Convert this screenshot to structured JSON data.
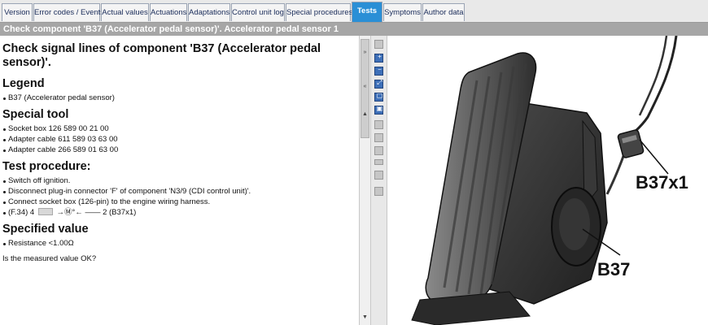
{
  "tabs": [
    {
      "label": "Version",
      "active": false
    },
    {
      "label": "Error codes / Events",
      "active": false
    },
    {
      "label": "Actual values",
      "active": false
    },
    {
      "label": "Actuations",
      "active": false
    },
    {
      "label": "Adaptations",
      "active": false
    },
    {
      "label": "Control unit log",
      "active": false
    },
    {
      "label": "Special procedures",
      "active": false
    },
    {
      "label": "Tests",
      "active": true
    },
    {
      "label": "Symptoms",
      "active": false
    },
    {
      "label": "Author data",
      "active": false
    }
  ],
  "title_bar": "Check component 'B37 (Accelerator pedal sensor)'. Accelerator pedal sensor 1",
  "content": {
    "heading": "Check signal lines of component 'B37 (Accelerator pedal sensor)'.",
    "legend_heading": "Legend",
    "legend_items": [
      "B37 (Accelerator pedal sensor)"
    ],
    "special_tool_heading": "Special tool",
    "special_tool_items": [
      "Socket box 126 589 00 21 00",
      "Adapter cable 611 589 03 63 00",
      "Adapter cable 266 589 01 63 00"
    ],
    "procedure_heading": "Test procedure:",
    "procedure_items": [
      "Switch off ignition.",
      "Disconnect plug-in connector 'F' of component 'N3/9 (CDI control unit)'.",
      "Connect socket box (126-pin) to the engine wiring harness."
    ],
    "measurement_prefix": "(F.34) 4",
    "measurement_suffix": "→Ⓜ°← —— 2 (B37x1)",
    "specified_heading": "Specified value",
    "specified_items": [
      "Resistance <1.00Ω"
    ],
    "question": "Is the measured value OK?"
  },
  "image_labels": {
    "connector": "B37x1",
    "sensor": "B37"
  },
  "toolbar": {
    "buttons": [
      "zoom-in-icon",
      "zoom-out-icon",
      "zoom-fit-icon",
      "zoom-box-icon",
      "print-icon"
    ],
    "collapse_arrows": [
      "»",
      "«"
    ]
  },
  "colors": {
    "active_tab": "#2a8fd6",
    "title_bar": "#a6a6a6"
  }
}
